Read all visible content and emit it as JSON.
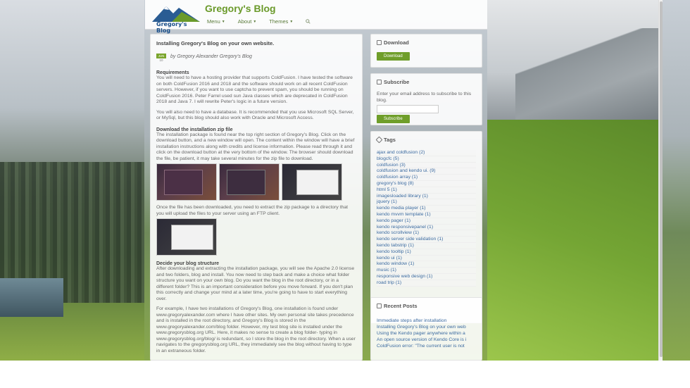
{
  "header": {
    "logo_text": "Gregory's Blog",
    "site_title": "Gregory's Blog",
    "nav": [
      "Menu",
      "About",
      "Themes"
    ]
  },
  "post": {
    "title": "Installing Gregory's Blog on your own website.",
    "date_month": "JUN",
    "date_day": "10",
    "author": "by Gregory Alexander Gregory's Blog",
    "sections": [
      {
        "heading": "Requirements",
        "paragraphs": [
          "You will need to have a hosting provider that supports ColdFusion. I have tested the software on both ColdFusion 2016 and 2018 and the software should work on all recent ColdFusion servers. However, if you want to use captcha to prevent spam, you should be running on ColdFusion 2016. Peter Farrel used sun Java classes which are deprecated in ColdFusion 2018 and Java 7. I will rewrite Peter's logic in a future version.",
          "You will also need to have a database. It is recommended that you use Microsoft SQL Server, or MySql, but this blog should also work with Oracle and Microsoft Access."
        ]
      },
      {
        "heading": "Download the installation zip file",
        "paragraphs": [
          "The installation package is found near the top right section of Gregory's Blog. Click on the download button, and a new window will open. The content within the window will have a brief installation instructions along with credits and license information. Please read through it and click on the download button at the very bottom of the window. The browser should download the file, be patient, it may take several minutes for the zip file to download."
        ]
      },
      {
        "heading": "",
        "paragraphs": [
          "Once the file has been downloaded, you need to extract the zip package to a directory that you will upload the files to your server using an FTP client."
        ]
      },
      {
        "heading": "Decide your blog structure",
        "paragraphs": [
          "After downloading and extracting the installation package, you will see the Apache 2.0 license and two folders, blog and install. You now need to step back and make a choice what folder structure you want on your own blog. Do you want the blog in the root directory, or in a different folder? This is an important consideration before you move forward. If you don't plan this correctly and change your mind at a later time, you're going to have to start everything over.",
          "For example, I have two installations of Gregory's Blog, one installation is found under www.gregoryalexander.com where I have other sites. My own personal site takes precedence and is installed in the root directory, and Gregory's Blog is stored in the www.gregoryalexander.com/blog folder. However, my test blog site is installed under the www.gregorysblog.org URL. Here, it makes no sense to create a blog folder- typing in www.gregorysblog.org/blog/ is redundant, so I store the blog in the root directory. When a user navigates to the gregorysblog.org URL, they immediately see the blog without having to type in an extraneous folder."
        ]
      }
    ]
  },
  "sidebar": {
    "download": {
      "title": "Download",
      "button": "Download"
    },
    "subscribe": {
      "title": "Subscribe",
      "text": "Enter your email address to subscribe to this blog.",
      "button": "Subscribe"
    },
    "tags": {
      "title": "Tags",
      "items": [
        "ajax and coldfusion (2)",
        "blogcfc (5)",
        "coldfusion (3)",
        "coldfusion and kendo ui. (9)",
        "coldfusion array (1)",
        "gregory's blog (8)",
        "html 5 (1)",
        "imagesloaded library (1)",
        "jquery (1)",
        "kendo media player (1)",
        "kendo mvvm template (1)",
        "kendo pager (1)",
        "kendo responsivepanel (1)",
        "kendo scrollview (1)",
        "kendo server side validation (1)",
        "kendo tabstrip (1)",
        "kendo tooltip (1)",
        "kendo ui (1)",
        "kendo window (1)",
        "music (1)",
        "responsive web design (1)",
        "road trip (1)"
      ]
    },
    "recent": {
      "title": "Recent Posts",
      "items": [
        "Immediate steps after installation",
        "Installing Gregory's Blog on your own web",
        "Using the Kendo pager anywhere within a",
        "An open source version of Kendo Core is i",
        "ColdFusion error: \"The current user is not"
      ]
    }
  },
  "colors": {
    "accent": "#6f9e2a",
    "link": "#3b6aa0",
    "title": "#6a9a2a"
  }
}
